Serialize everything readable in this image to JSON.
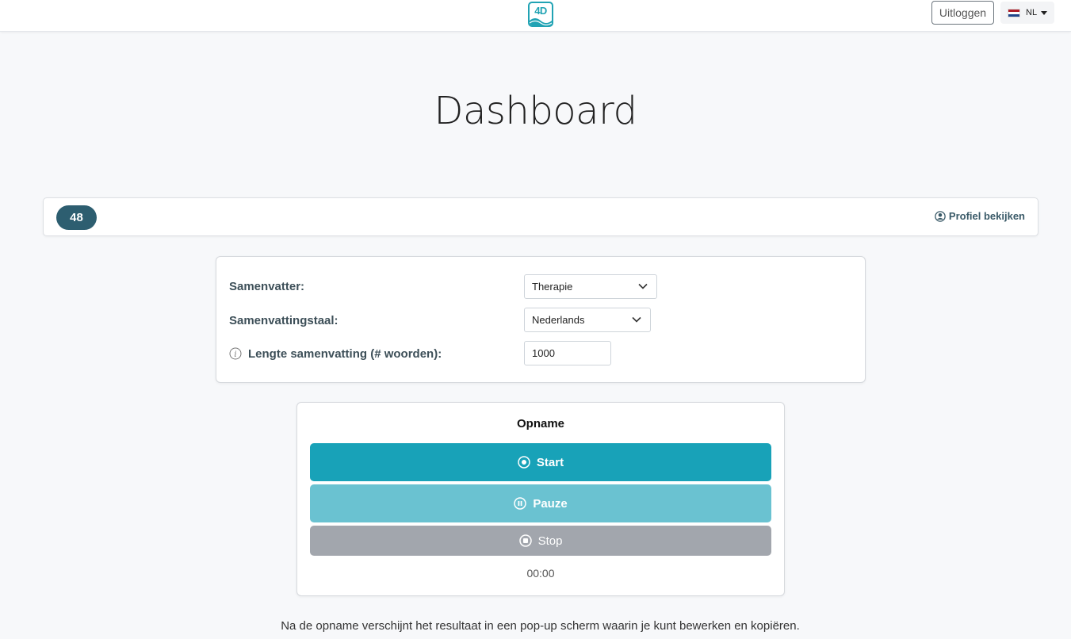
{
  "navbar": {
    "logo_text": "4D",
    "logout_label": "Uitloggen",
    "language": {
      "code": "NL",
      "flag_colors": [
        "#ae1c28",
        "#ffffff",
        "#21468b"
      ]
    }
  },
  "page": {
    "title": "Dashboard"
  },
  "profile_bar": {
    "count": "48",
    "profile_link": "Profiel bekijken",
    "profile_icon": "user-circle-icon"
  },
  "settings": {
    "summarizer": {
      "label": "Samenvatter:",
      "value": "Therapie"
    },
    "summary_language": {
      "label": "Samenvattingstaal:",
      "value": "Nederlands"
    },
    "summary_length": {
      "label": "Lengte samenvatting (# woorden):",
      "value": "1000",
      "info_icon": "info-icon"
    }
  },
  "recording": {
    "title": "Opname",
    "start_label": "Start",
    "pause_label": "Pauze",
    "stop_label": "Stop",
    "timer": "00:00"
  },
  "footer": {
    "note": "Na de opname verschijnt het resultaat in een pop-up scherm waarin je kunt bewerken en kopiëren."
  },
  "colors": {
    "accent": "#18a2b8",
    "badge": "#2d5e70",
    "pause": "#6ac2d1",
    "stop": "#a2a6ad"
  }
}
